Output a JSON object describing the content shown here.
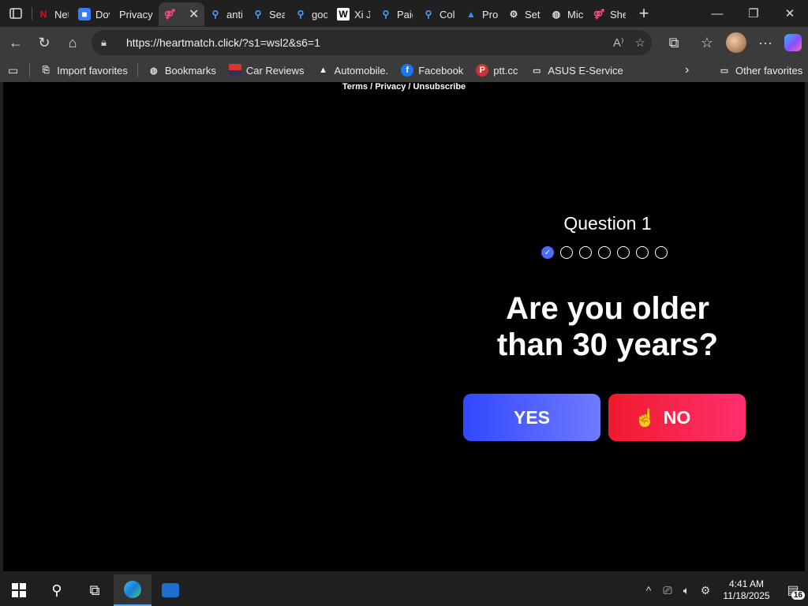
{
  "tabs": [
    {
      "label": "Netf",
      "icon": "netflix-icon",
      "color": "#e50914"
    },
    {
      "label": "Dov",
      "icon": "roblox-icon",
      "color": "#3a7bff"
    },
    {
      "label": "Privacy e",
      "icon": "",
      "color": ""
    },
    {
      "label": "",
      "icon": "heartmatch-icon",
      "color": "#ff4f8b",
      "active": true
    },
    {
      "label": "anti",
      "icon": "search-icon",
      "color": "#4fa3ff"
    },
    {
      "label": "Sea",
      "icon": "search-icon",
      "color": "#4fa3ff"
    },
    {
      "label": "goo",
      "icon": "search-icon",
      "color": "#4fa3ff"
    },
    {
      "label": "Xi Ji",
      "icon": "wikipedia-icon",
      "color": "#ffffff"
    },
    {
      "label": "Paig",
      "icon": "search-icon",
      "color": "#4fa3ff"
    },
    {
      "label": "Coll",
      "icon": "search-icon",
      "color": "#4fa3ff"
    },
    {
      "label": "Pro",
      "icon": "triangle-logo-icon",
      "color": "#3a8bff"
    },
    {
      "label": "Sett",
      "icon": "gear-icon",
      "color": "#dddddd"
    },
    {
      "label": "Mic",
      "icon": "globe-icon",
      "color": "#dddddd"
    },
    {
      "label": "She",
      "icon": "heartmatch-icon",
      "color": "#ff4f8b"
    }
  ],
  "address": {
    "url": "https://heartmatch.click/?s1=wsl2&s6=1"
  },
  "favorites": [
    {
      "label": "Import favorites",
      "icon": "import-icon",
      "color": "#dddddd"
    },
    {
      "label": "Bookmarks",
      "icon": "globe-icon",
      "color": "#dddddd"
    },
    {
      "label": "Car Reviews",
      "icon": "flag-icon",
      "color": "#d33"
    },
    {
      "label": "Automobile.",
      "icon": "triangle-logo-icon",
      "color": "#ffffff"
    },
    {
      "label": "Facebook",
      "icon": "facebook-icon",
      "color": "#1877f2"
    },
    {
      "label": "ptt.cc",
      "icon": "ptt-icon",
      "color": "#d33"
    },
    {
      "label": "ASUS E-Service",
      "icon": "folder-icon",
      "color": "#dddddd"
    }
  ],
  "other_favorites": "Other favorites",
  "page": {
    "terms": "Terms / Privacy / Unsubscribe",
    "question_title": "Question 1",
    "question_line1": "Are you older",
    "question_line2": "than 30 years?",
    "yes_label": "YES",
    "no_label": "NO",
    "progress_total": 7,
    "progress_done": 1
  },
  "taskbar": {
    "time": "4:41 AM",
    "date": "11/18/2025",
    "notifications": "16"
  }
}
